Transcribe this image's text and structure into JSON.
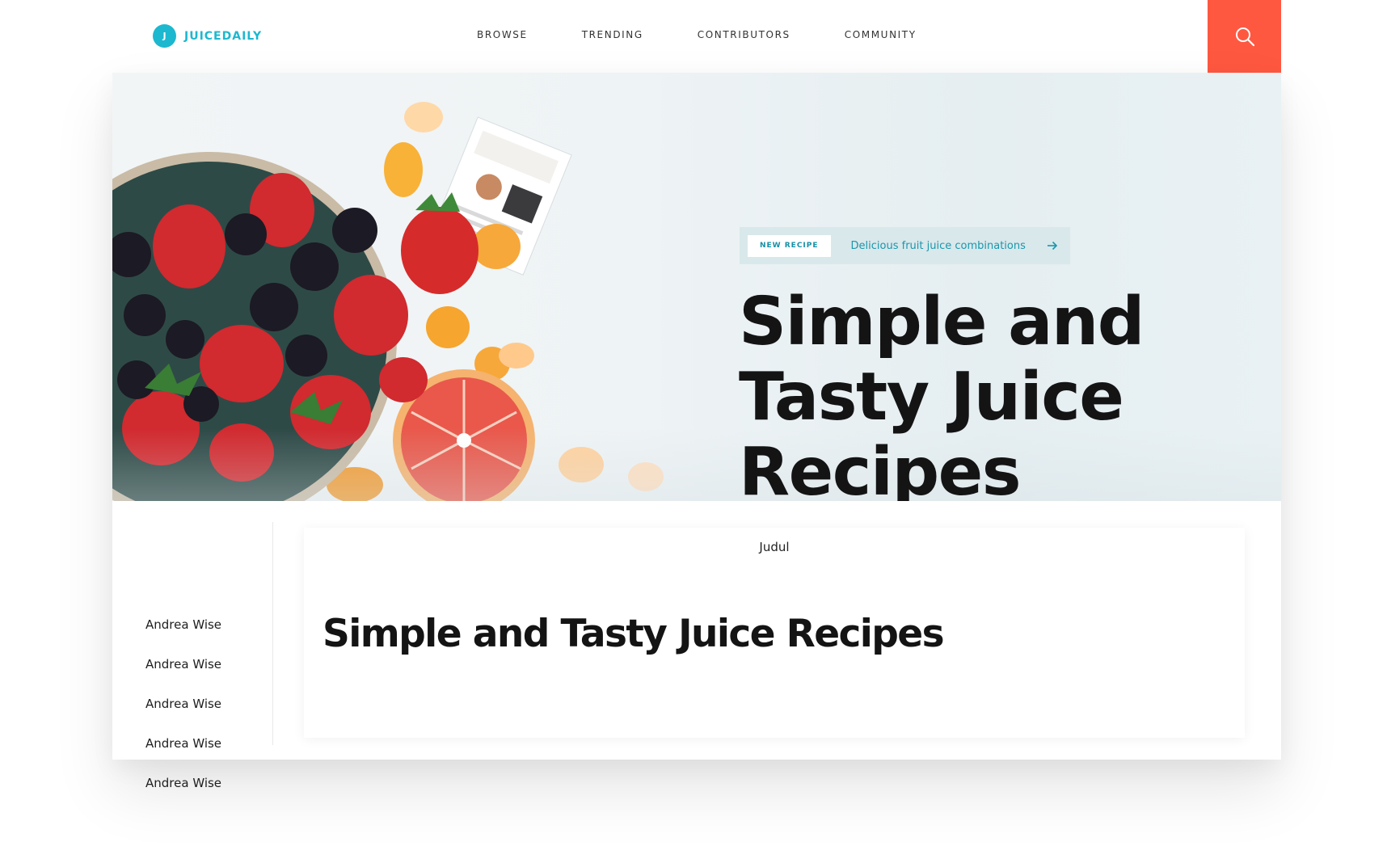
{
  "brand": {
    "mark": "J",
    "name": "JUICEDAILY",
    "color": "#1cb8cf"
  },
  "nav": {
    "items": [
      "BROWSE",
      "TRENDING",
      "CONTRIBUTORS",
      "COMMUNITY"
    ]
  },
  "search": {
    "icon": "search-icon",
    "bg_color": "#ff5841"
  },
  "hero": {
    "badge_label": "NEW RECIPE",
    "badge_text": "Delicious fruit juice combinations",
    "badge_icon": "arrow-right-icon",
    "title_lines": [
      "Simple and",
      "Tasty Juice",
      "Recipes"
    ]
  },
  "sidebar": {
    "items": [
      "Andrea Wise",
      "Andrea Wise",
      "Andrea Wise",
      "Andrea Wise",
      "Andrea Wise"
    ]
  },
  "content": {
    "label": "Judul",
    "title": "Simple and Tasty Juice Recipes"
  }
}
